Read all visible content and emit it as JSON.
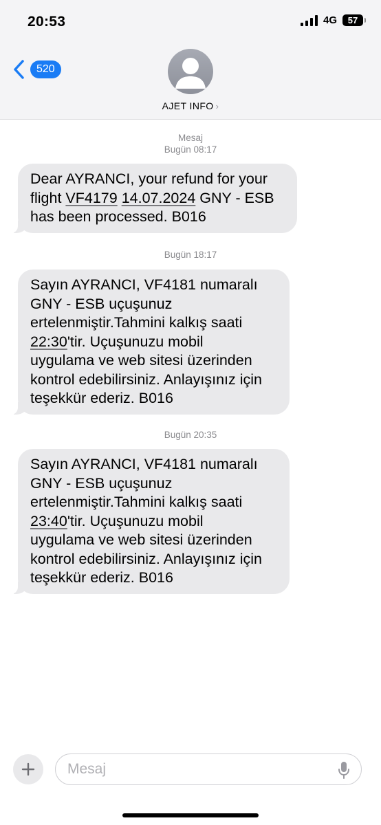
{
  "status_bar": {
    "time": "20:53",
    "network": "4G",
    "battery": "57"
  },
  "nav": {
    "unread_count": "520",
    "contact_name": "AJET INFO",
    "contact_chevron": "›"
  },
  "thread": {
    "messages": [
      {
        "stamp_label": "Mesaj",
        "stamp_time": "Bugün 08:17",
        "lines": [
          "Dear AYRANCI, your refund for your",
          "flight ",
          "VF4179",
          " ",
          "14.07.2024",
          " GNY - ESB",
          "has been processed. B016"
        ]
      },
      {
        "stamp_time": "Bugün 18:17",
        "lines": [
          "Sayın AYRANCI, VF4181 numaralı",
          "GNY - ESB uçuşunuz",
          "ertelenmiştir.Tahmini kalkış saati",
          "22:30",
          "'tir. Uçuşunuzu mobil",
          "uygulama ve web sitesi üzerinden",
          "kontrol edebilirsiniz. Anlayışınız için",
          "teşekkür ederiz. B016"
        ]
      },
      {
        "stamp_time": "Bugün 20:35",
        "lines": [
          "Sayın AYRANCI, VF4181 numaralı",
          "GNY - ESB uçuşunuz",
          "ertelenmiştir.Tahmini kalkış saati",
          "23:40",
          "'tir. Uçuşunuzu mobil",
          "uygulama ve web sitesi üzerinden",
          "kontrol edebilirsiniz. Anlayışınız için",
          "teşekkür ederiz. B016"
        ]
      }
    ]
  },
  "composer": {
    "placeholder": "Mesaj",
    "plus_symbol": "+"
  },
  "colors": {
    "accent": "#1a7cf5",
    "bubble": "#e9e9eb",
    "header_bg": "#f4f4f6",
    "stamp": "#8a8a8e"
  },
  "icons": [
    "signal-icon",
    "battery-icon",
    "back-chevron-icon",
    "contact-avatar-icon",
    "plus-icon",
    "microphone-icon"
  ]
}
